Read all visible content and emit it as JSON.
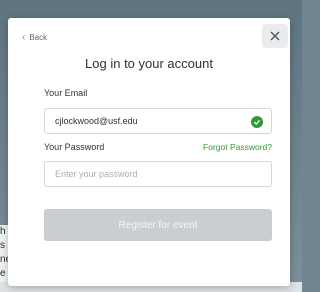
{
  "background": {
    "side_text": [
      "h",
      "s",
      "ne",
      "e"
    ]
  },
  "modal": {
    "back_label": "Back",
    "close_icon": "close-icon",
    "title": "Log in to your account",
    "email": {
      "label": "Your Email",
      "value": "cjlockwood@usf.edu",
      "valid_icon": "check-circle-icon"
    },
    "password": {
      "label": "Your Password",
      "placeholder": "Enter your password",
      "forgot_label": "Forgot Password?"
    },
    "submit_label": "Register for event"
  },
  "colors": {
    "accent_green": "#2f9a3a",
    "button_disabled": "#c9ced3"
  }
}
